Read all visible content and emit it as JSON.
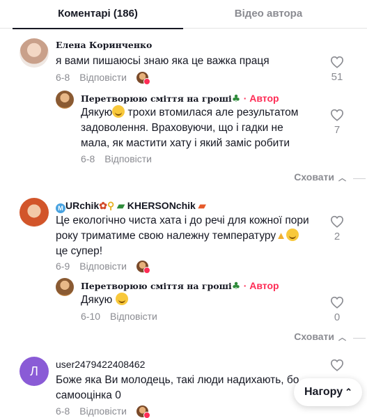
{
  "tabs": {
    "comments": "Коментарі (186)",
    "creator_videos": "Відео автора"
  },
  "reply_label": "Відповісти",
  "hide_label": "Сховати",
  "back_to_top": "Нагору",
  "author_tag": "· Автор",
  "comments": [
    {
      "username": "Елена Коринченко",
      "text": "я вами пишаюсьі знаю яка це важка праця",
      "date": "6-8",
      "likes": "51",
      "replies": [
        {
          "username": "Перетворюю сміття на гроші",
          "text_lines": [
            "Дякую",
            " трохи втомилася але результатом",
            "задоволення. Враховуючи, що і гадки не",
            "мала, як мастити хату і який заміс робити"
          ],
          "date": "6-8",
          "likes": "7"
        }
      ]
    },
    {
      "username_parts": [
        "URchik",
        "KHERSONchik"
      ],
      "text_lines": [
        "Це екологічно чиста хата і до речі для кожної пори",
        "року триматиме свою належну температуру",
        "це супер!"
      ],
      "date": "6-9",
      "likes": "2",
      "replies": [
        {
          "username": "Перетворюю сміття на гроші",
          "text": "Дякую",
          "date": "6-10",
          "likes": "0"
        }
      ]
    },
    {
      "avatar_letter": "Л",
      "username": "user2479422408462",
      "text_lines": [
        "Боже яка Ви молодець, такі люди надихають, бо",
        "самооцінка 0"
      ],
      "date": "6-8"
    }
  ],
  "colors": {
    "accent": "#fe2c55",
    "muted": "#8a8b91",
    "text": "#161823",
    "avatar_purple": "#8a5bd6"
  },
  "icons": [
    "heart-outline-icon",
    "chevron-up-icon",
    "double-chevron-up-icon",
    "clover-icon",
    "truck-icon"
  ]
}
